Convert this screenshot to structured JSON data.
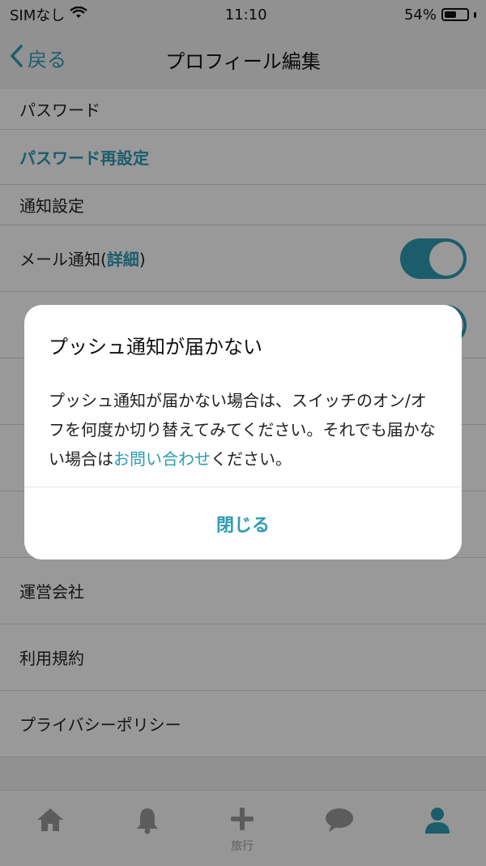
{
  "status": {
    "carrier": "SIMなし",
    "time": "11:10",
    "battery": "54%",
    "battery_level": 0.54
  },
  "nav": {
    "back_label": "戻る",
    "title": "プロフィール編集"
  },
  "list": {
    "password_label": "パスワード",
    "password_reset": "パスワード再設定",
    "notification_settings": "通知設定",
    "mail_notification": "メール通知(",
    "detail_link": "詳細",
    "mail_notification_suffix": ")",
    "company": "運営会社",
    "terms": "利用規約",
    "privacy": "プライバシーポリシー"
  },
  "tabs": {
    "trip": "旅行"
  },
  "dialog": {
    "title": "プッシュ通知が届かない",
    "body_pre": "プッシュ通知が届かない場合は、スイッチのオン/オフを何度か切り替えてみてください。それでも届かない場合は",
    "body_link": "お問い合わせ",
    "body_post": "ください。",
    "close": "閉じる"
  }
}
